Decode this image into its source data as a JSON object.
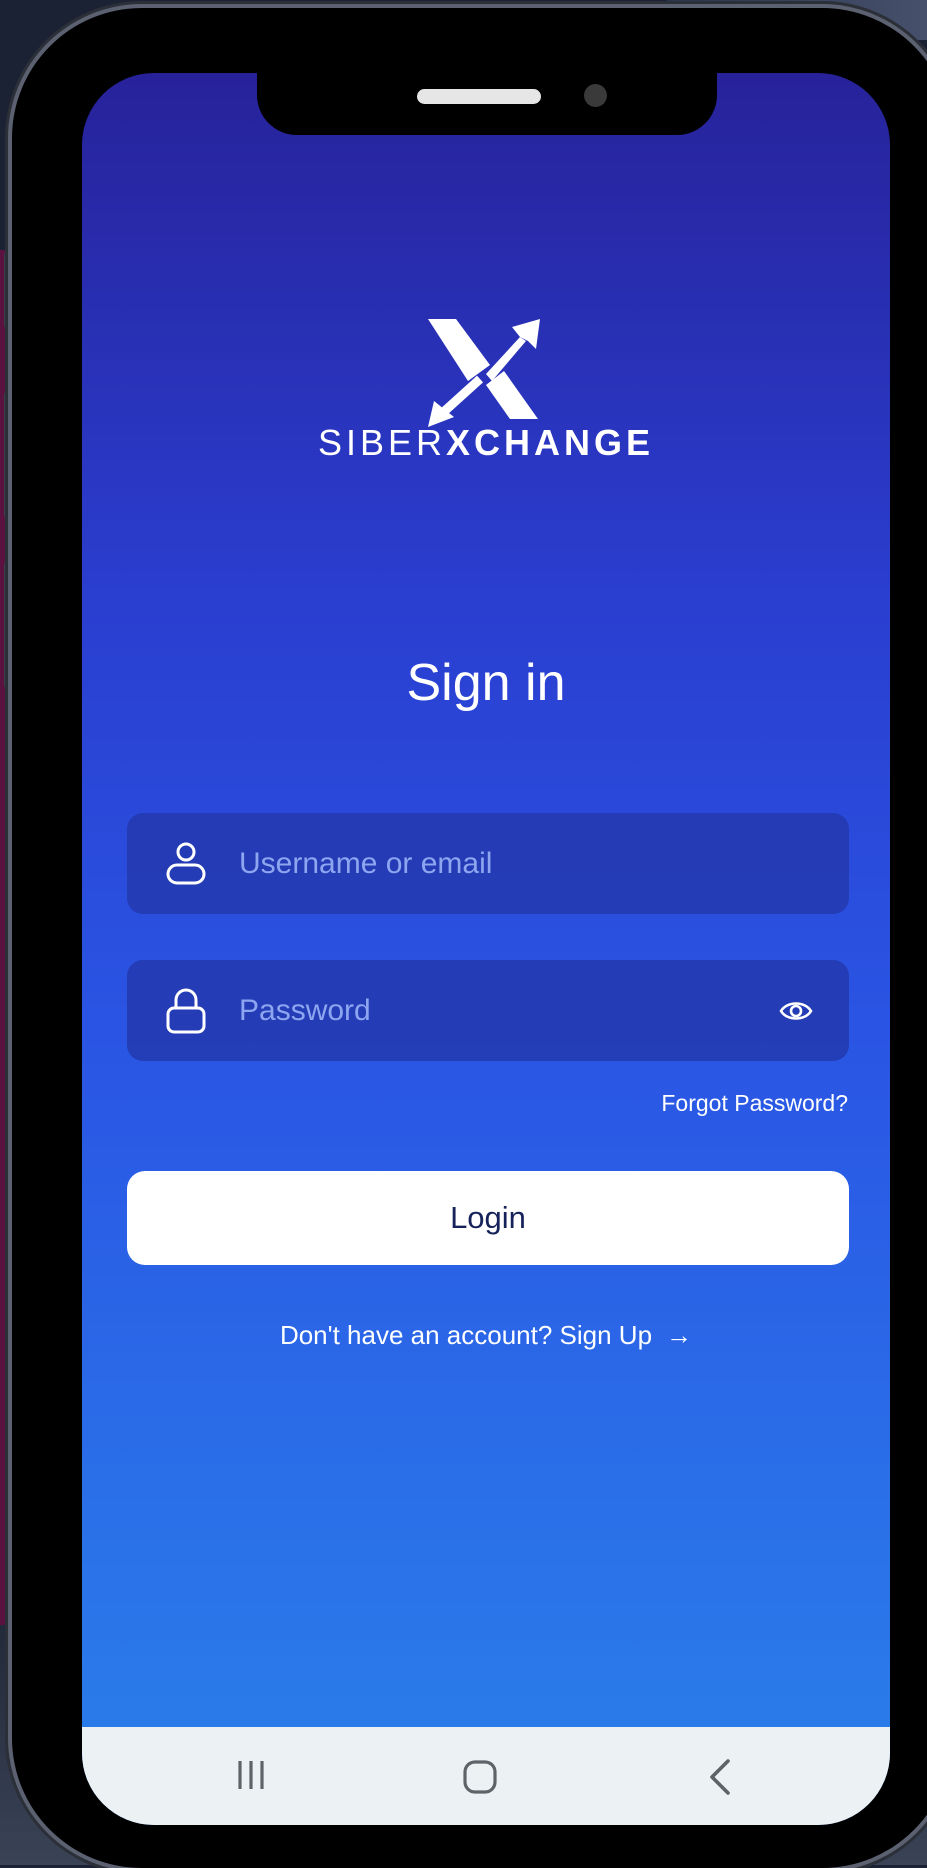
{
  "brand": {
    "name_light": "SIBER",
    "name_bold": "XCHANGE",
    "logo_icon": "siberxchange-x-logo"
  },
  "signin": {
    "title": "Sign in",
    "username_placeholder": "Username or email",
    "password_placeholder": "Password",
    "forgot_label": "Forgot Password?",
    "login_label": "Login",
    "signup_prompt": "Don't have an account? Sign Up",
    "signup_arrow": "→"
  },
  "icons": {
    "username": "user-icon",
    "password": "lock-icon",
    "toggle_visibility": "eye-icon"
  },
  "navbar": {
    "recent": "recent-apps-icon",
    "home": "home-icon",
    "back": "back-icon"
  },
  "colors": {
    "gradient_top": "#27229a",
    "gradient_bottom": "#2a80ea",
    "field_bg": "#2337aa",
    "placeholder": "#8ea6f0",
    "button_text": "#16225a",
    "navbar_bg": "#ecf1f4"
  }
}
